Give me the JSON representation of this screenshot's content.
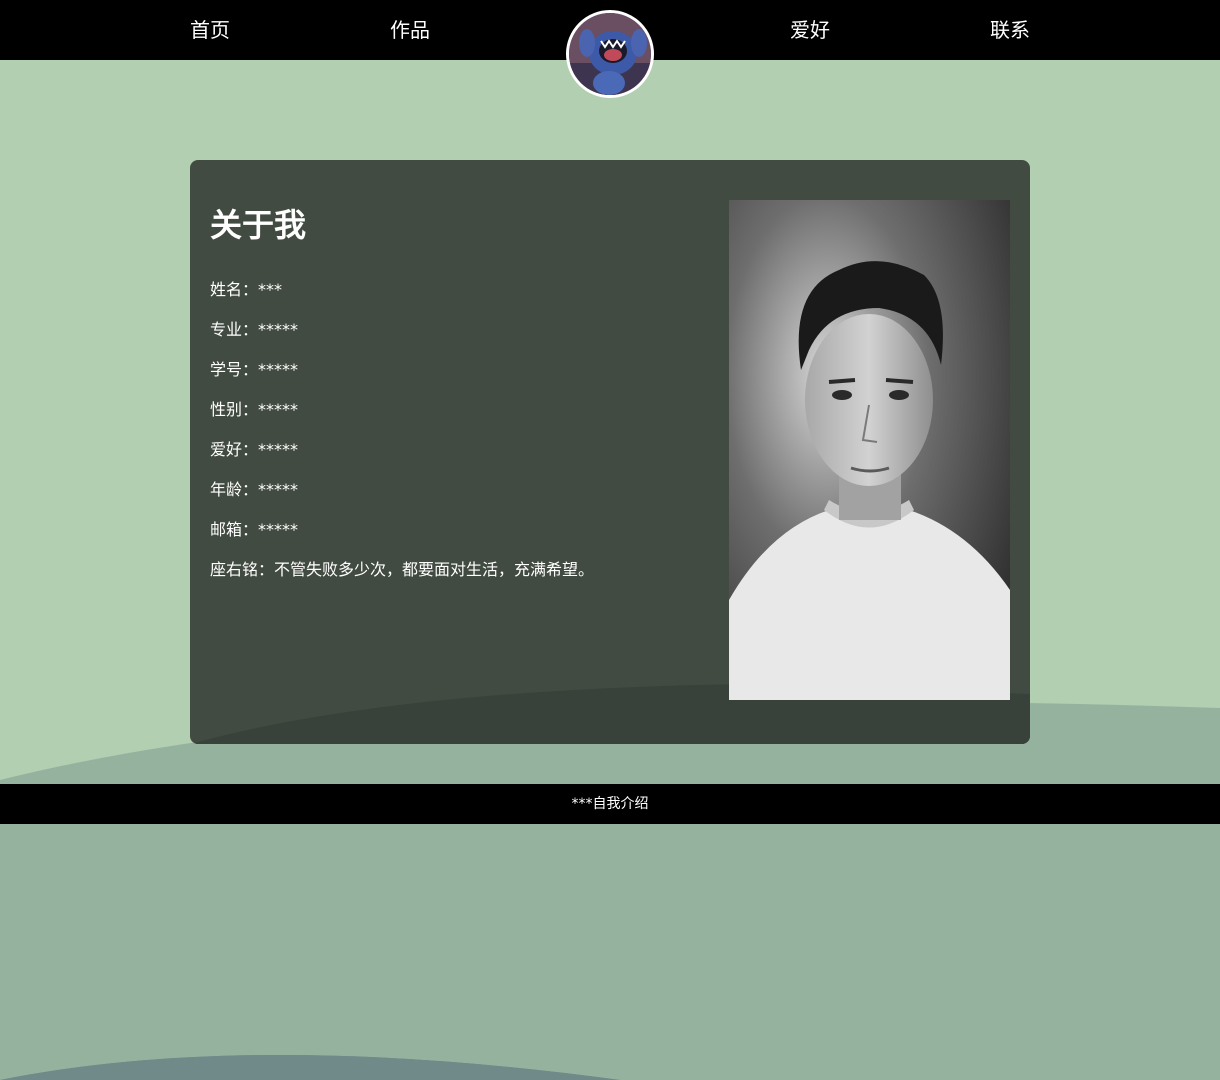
{
  "nav": {
    "items": [
      {
        "label": "首页"
      },
      {
        "label": "作品"
      },
      {
        "label": "爱好"
      },
      {
        "label": "联系"
      }
    ],
    "avatar_icon": "cartoon-avatar-icon"
  },
  "about": {
    "title": "关于我",
    "rows": [
      {
        "text": "姓名：***"
      },
      {
        "text": "专业：*****"
      },
      {
        "text": "学号：*****"
      },
      {
        "text": "性别：*****"
      },
      {
        "text": "爱好：*****"
      },
      {
        "text": "年龄：*****"
      },
      {
        "text": "邮箱：*****"
      },
      {
        "text": "座右铭：不管失败多少次，都要面对生活，充满希望。"
      }
    ]
  },
  "footer": {
    "text": "***自我介绍"
  },
  "colors": {
    "background": "#b3cfb1",
    "wave_light": "#95b29f",
    "wave_dark": "#6f8a88",
    "card": "#424b41",
    "nav": "#000000"
  }
}
